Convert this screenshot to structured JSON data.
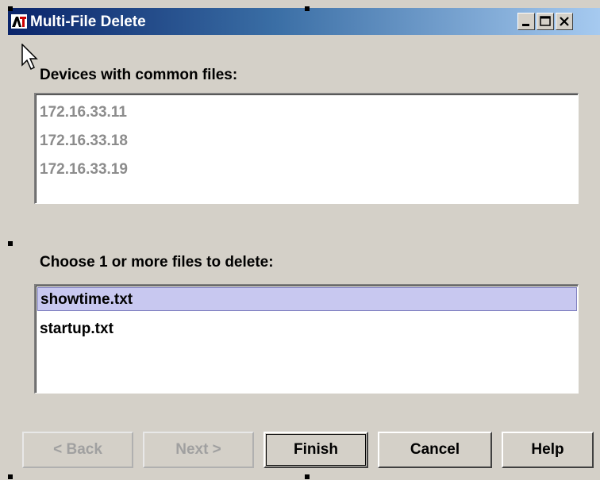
{
  "window": {
    "title": "Multi-File Delete",
    "app_icon": "allied-telesyn-logo-icon",
    "controls": [
      "minimize-icon",
      "maximize-icon",
      "close-icon"
    ]
  },
  "devices": {
    "label": "Devices with common files:",
    "items": [
      "172.16.33.11",
      "172.16.33.18",
      "172.16.33.19"
    ]
  },
  "files": {
    "label": "Choose 1 or more files to delete:",
    "items": [
      "showtime.txt",
      "startup.txt"
    ],
    "selected": "showtime.txt"
  },
  "buttons": {
    "back": "< Back",
    "next": "Next >",
    "finish": "Finish",
    "cancel": "Cancel",
    "help": "Help"
  },
  "colors": {
    "titlebar_start": "#0a246a",
    "titlebar_end": "#a6caf0",
    "selection": "#c8c8f0",
    "disabled_text": "#8c8c8c"
  }
}
